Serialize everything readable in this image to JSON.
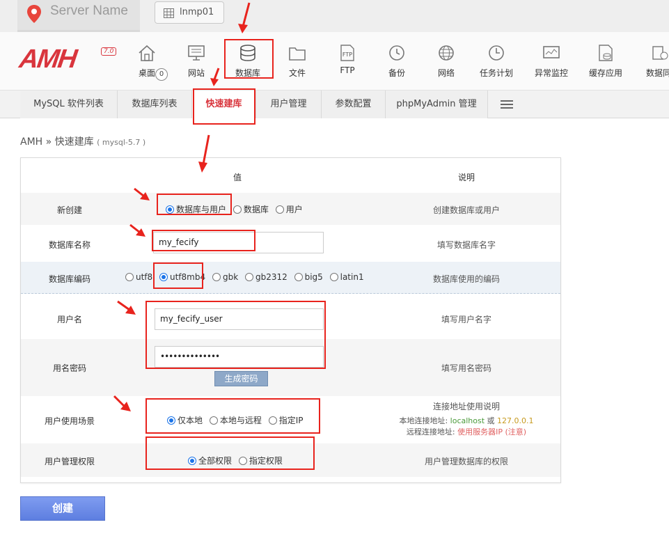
{
  "topbar": {
    "server_name": "Server Name",
    "host_label": "lnmp01"
  },
  "header": {
    "logo": "AMH",
    "logo_version": "7.0",
    "desk_badge": "0",
    "nav": [
      {
        "label": "桌面",
        "icon": "house-icon"
      },
      {
        "label": "网站",
        "icon": "monitor-icon"
      },
      {
        "label": "数据库",
        "icon": "database-icon"
      },
      {
        "label": "文件",
        "icon": "folder-icon"
      },
      {
        "label": "FTP",
        "icon": "ftp-icon"
      },
      {
        "label": "备份",
        "icon": "backup-clock-icon"
      },
      {
        "label": "网络",
        "icon": "globe-icon"
      },
      {
        "label": "任务计划",
        "icon": "clock-icon"
      },
      {
        "label": "异常监控",
        "icon": "monitor-graph-icon"
      },
      {
        "label": "缓存应用",
        "icon": "cache-icon"
      },
      {
        "label": "数据同",
        "icon": "sync-icon"
      }
    ]
  },
  "subnav": {
    "tabs": [
      "MySQL 软件列表",
      "数据库列表",
      "快速建库",
      "用户管理",
      "参数配置",
      "phpMyAdmin 管理"
    ]
  },
  "breadcrumb": {
    "root": "AMH",
    "sep": " » ",
    "page": "快速建库",
    "version": "( mysql-5.7 )"
  },
  "form": {
    "header_value": "值",
    "header_desc": "说明",
    "create_type": {
      "label": "新创建",
      "options": [
        "数据库与用户",
        "数据库",
        "用户"
      ],
      "selected": "数据库与用户",
      "desc": "创建数据库或用户"
    },
    "db_name": {
      "label": "数据库名称",
      "value": "my_fecify",
      "desc": "填写数据库名字"
    },
    "db_charset": {
      "label": "数据库编码",
      "options": [
        "utf8",
        "utf8mb4",
        "gbk",
        "gb2312",
        "big5",
        "latin1"
      ],
      "selected": "utf8mb4",
      "desc": "数据库使用的编码"
    },
    "username": {
      "label": "用户名",
      "value": "my_fecify_user",
      "desc": "填写用户名字"
    },
    "password": {
      "label": "用名密码",
      "value": "••••••••••••••",
      "generate_label": "生成密码",
      "desc": "填写用名密码"
    },
    "scope": {
      "label": "用户使用场景",
      "options": [
        "仅本地",
        "本地与远程",
        "指定IP"
      ],
      "selected": "仅本地",
      "desc_title": "连接地址使用说明",
      "local_prefix": "本地连接地址: ",
      "local_host": "localhost",
      "local_or": " 或 ",
      "local_ip": "127.0.0.1",
      "remote_prefix": "远程连接地址: ",
      "remote_value": "使用服务器IP (注意)"
    },
    "privilege": {
      "label": "用户管理权限",
      "options": [
        "全部权限",
        "指定权限"
      ],
      "selected": "全部权限",
      "desc": "用户管理数据库的权限"
    }
  },
  "create_button": "创建",
  "colors": {
    "brand_red": "#d9353d",
    "annotation_red": "#e8231d",
    "radio_blue": "#1a73e8",
    "create_button": "#6c8be6"
  }
}
